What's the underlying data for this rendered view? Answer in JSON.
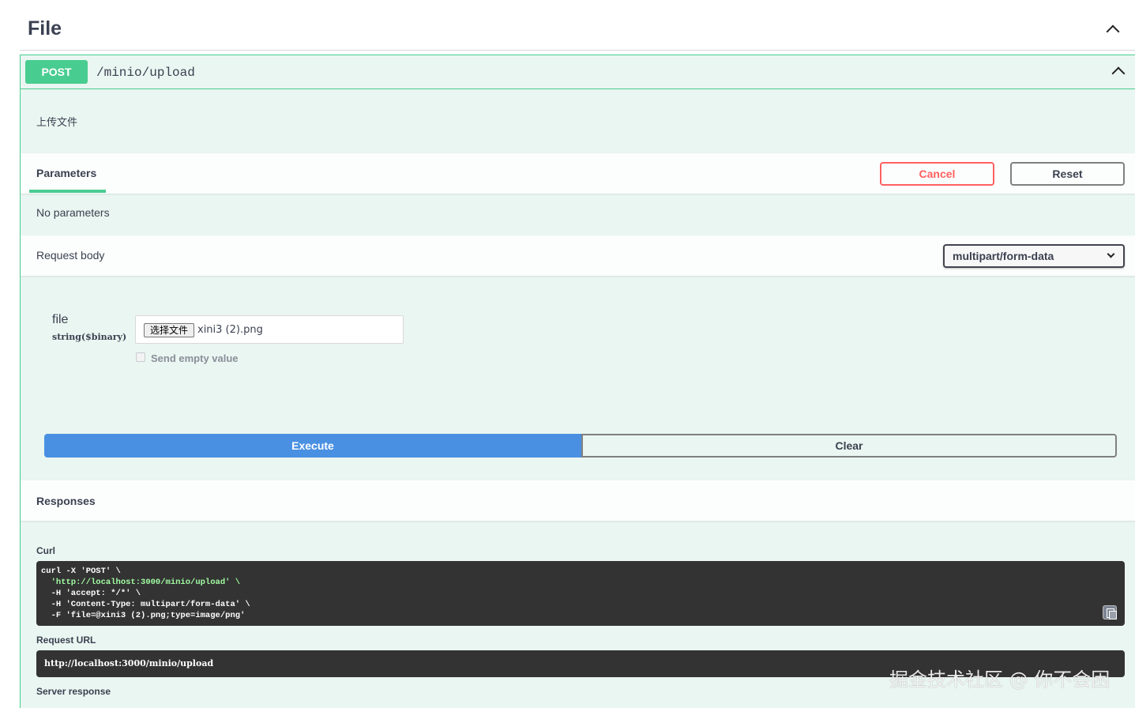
{
  "tag": {
    "title": "File"
  },
  "operation": {
    "method": "POST",
    "path": "/minio/upload",
    "description": "上传文件"
  },
  "parameters": {
    "tab_label": "Parameters",
    "cancel_label": "Cancel",
    "reset_label": "Reset",
    "empty_text": "No parameters"
  },
  "request_body": {
    "title": "Request body",
    "content_type": "multipart/form-data",
    "field": {
      "name": "file",
      "type": "string($binary)",
      "choose_label": "选择文件",
      "file_name": "xini3 (2).png",
      "send_empty_label": "Send empty value",
      "send_empty_checked": false
    }
  },
  "actions": {
    "execute_label": "Execute",
    "clear_label": "Clear"
  },
  "responses": {
    "title": "Responses",
    "curl_label": "Curl",
    "curl_lines": [
      "curl -X 'POST' \\",
      "  'http://localhost:3000/minio/upload' \\",
      "  -H 'accept: */*' \\",
      "  -H 'Content-Type: multipart/form-data' \\",
      "  -F 'file=@xini3 (2).png;type=image/png'"
    ],
    "request_url_label": "Request URL",
    "request_url": "http://localhost:3000/minio/upload",
    "server_response_label": "Server response"
  },
  "watermark": "掘金技术社区 @ 你不会困",
  "colors": {
    "post": "#49cc90",
    "execute": "#4990e2",
    "cancel": "#ff6060",
    "code_bg": "#333333",
    "code_string": "#a2fca2"
  }
}
